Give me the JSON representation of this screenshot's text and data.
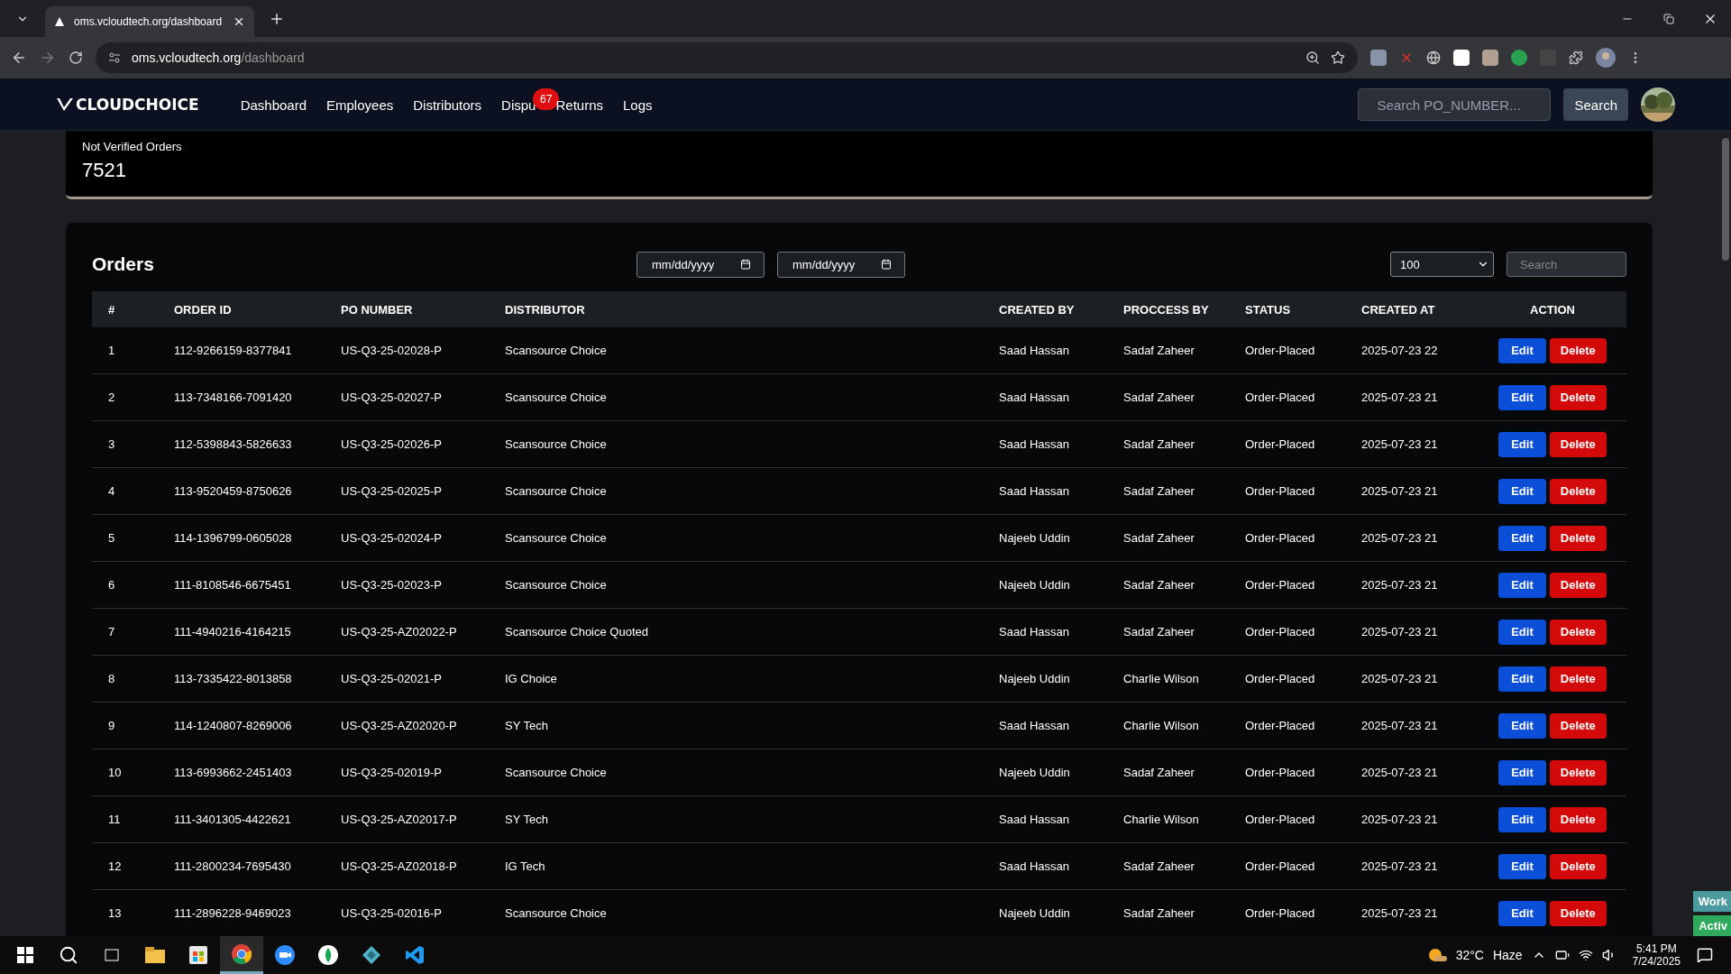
{
  "browser": {
    "tab_title": "oms.vcloudtech.org/dashboard",
    "url_host": "oms.vcloudtech.org",
    "url_path": "/dashboard"
  },
  "navbar": {
    "brand": "CLOUDCHOICE",
    "links": [
      {
        "label": "Dashboard"
      },
      {
        "label": "Employees"
      },
      {
        "label": "Distributors"
      },
      {
        "label": "Dispu",
        "badge": "67"
      },
      {
        "label": "Returns"
      },
      {
        "label": "Logs"
      }
    ],
    "search_placeholder": "Search PO_NUMBER...",
    "search_button": "Search"
  },
  "stat": {
    "label": "Not Verified Orders",
    "value": "7521"
  },
  "orders": {
    "title": "Orders",
    "date_from": "mm/dd/yyyy",
    "date_to": "mm/dd/yyyy",
    "page_size": "100",
    "search_placeholder": "Search",
    "columns": [
      "#",
      "ORDER ID",
      "PO NUMBER",
      "DISTRIBUTOR",
      "CREATED BY",
      "PROCCESS BY",
      "STATUS",
      "CREATED AT",
      "ACTION"
    ],
    "rows": [
      {
        "cells": [
          "1",
          "112-9266159-8377841",
          "US-Q3-25-02028-P",
          "Scansource Choice",
          "Saad Hassan",
          "Sadaf Zaheer",
          "Order-Placed",
          "2025-07-23 22"
        ],
        "edit": "Edit",
        "delete": "Delete"
      },
      {
        "cells": [
          "2",
          "113-7348166-7091420",
          "US-Q3-25-02027-P",
          "Scansource Choice",
          "Saad Hassan",
          "Sadaf Zaheer",
          "Order-Placed",
          "2025-07-23 21"
        ],
        "edit": "Edit",
        "delete": "Delete"
      },
      {
        "cells": [
          "3",
          "112-5398843-5826633",
          "US-Q3-25-02026-P",
          "Scansource Choice",
          "Saad Hassan",
          "Sadaf Zaheer",
          "Order-Placed",
          "2025-07-23 21"
        ],
        "edit": "Edit",
        "delete": "Delete"
      },
      {
        "cells": [
          "4",
          "113-9520459-8750626",
          "US-Q3-25-02025-P",
          "Scansource Choice",
          "Saad Hassan",
          "Sadaf Zaheer",
          "Order-Placed",
          "2025-07-23 21"
        ],
        "edit": "Edit",
        "delete": "Delete"
      },
      {
        "cells": [
          "5",
          "114-1396799-0605028",
          "US-Q3-25-02024-P",
          "Scansource Choice",
          "Najeeb Uddin",
          "Sadaf Zaheer",
          "Order-Placed",
          "2025-07-23 21"
        ],
        "edit": "Edit",
        "delete": "Delete"
      },
      {
        "cells": [
          "6",
          "111-8108546-6675451",
          "US-Q3-25-02023-P",
          "Scansource Choice",
          "Najeeb Uddin",
          "Sadaf Zaheer",
          "Order-Placed",
          "2025-07-23 21"
        ],
        "edit": "Edit",
        "delete": "Delete"
      },
      {
        "cells": [
          "7",
          "111-4940216-4164215",
          "US-Q3-25-AZ02022-P",
          "Scansource Choice Quoted",
          "Saad Hassan",
          "Sadaf Zaheer",
          "Order-Placed",
          "2025-07-23 21"
        ],
        "edit": "Edit",
        "delete": "Delete"
      },
      {
        "cells": [
          "8",
          "113-7335422-8013858",
          "US-Q3-25-02021-P",
          "IG Choice",
          "Najeeb Uddin",
          "Charlie Wilson",
          "Order-Placed",
          "2025-07-23 21"
        ],
        "edit": "Edit",
        "delete": "Delete"
      },
      {
        "cells": [
          "9",
          "114-1240807-8269006",
          "US-Q3-25-AZ02020-P",
          "SY Tech",
          "Saad Hassan",
          "Charlie Wilson",
          "Order-Placed",
          "2025-07-23 21"
        ],
        "edit": "Edit",
        "delete": "Delete"
      },
      {
        "cells": [
          "10",
          "113-6993662-2451403",
          "US-Q3-25-02019-P",
          "Scansource Choice",
          "Najeeb Uddin",
          "Sadaf Zaheer",
          "Order-Placed",
          "2025-07-23 21"
        ],
        "edit": "Edit",
        "delete": "Delete"
      },
      {
        "cells": [
          "11",
          "111-3401305-4422621",
          "US-Q3-25-AZ02017-P",
          "SY Tech",
          "Saad Hassan",
          "Charlie Wilson",
          "Order-Placed",
          "2025-07-23 21"
        ],
        "edit": "Edit",
        "delete": "Delete"
      },
      {
        "cells": [
          "12",
          "111-2800234-7695430",
          "US-Q3-25-AZ02018-P",
          "IG Tech",
          "Saad Hassan",
          "Sadaf Zaheer",
          "Order-Placed",
          "2025-07-23 21"
        ],
        "edit": "Edit",
        "delete": "Delete"
      },
      {
        "cells": [
          "13",
          "111-2896228-9469023",
          "US-Q3-25-02016-P",
          "Scansource Choice",
          "Najeeb Uddin",
          "Sadaf Zaheer",
          "Order-Placed",
          "2025-07-23 21"
        ],
        "edit": "Edit",
        "delete": "Delete"
      }
    ]
  },
  "overlay_tags": [
    {
      "label": "Work",
      "color": "#4a9aa0"
    },
    {
      "label": "Activ",
      "color": "#2eaa5c"
    }
  ],
  "taskbar": {
    "temperature": "32°C",
    "condition": "Haze",
    "time": "5:41 PM",
    "date": "7/24/2025"
  }
}
